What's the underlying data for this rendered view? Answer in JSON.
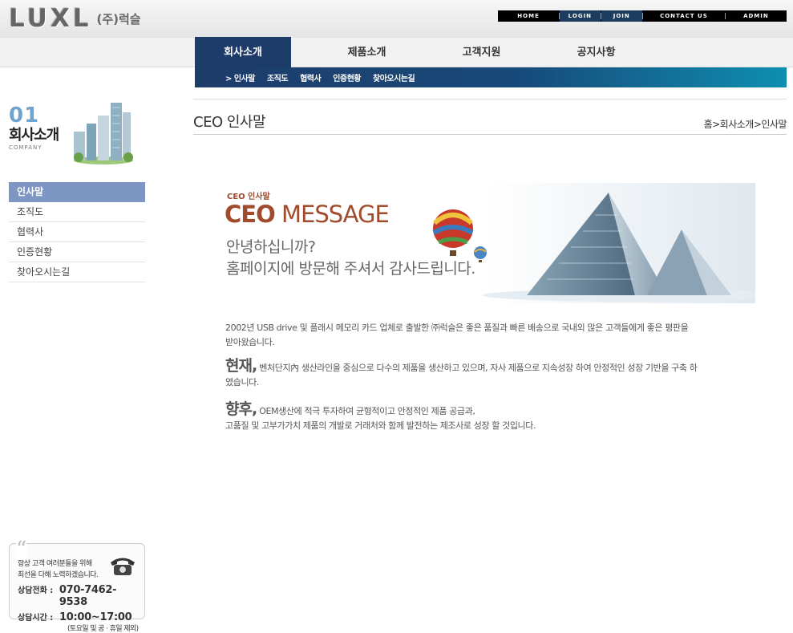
{
  "header": {
    "logo_word": "LUXL",
    "logo_company": "(주)럭슬",
    "util_links": [
      "HOME",
      "LOGIN",
      "JOIN",
      "CONTACT US",
      "ADMIN"
    ]
  },
  "gnb": {
    "items": [
      "회사소개",
      "제품소개",
      "고객지원",
      "공지사항"
    ],
    "active_index": 0
  },
  "subnav": {
    "items": [
      "> 인사말",
      "조직도",
      "협력사",
      "인증현황",
      "찾아오시는길"
    ]
  },
  "sidebar": {
    "section_number": "01",
    "section_title": "회사소개",
    "section_subtitle": "COMPANY",
    "menu": [
      "인사말",
      "조직도",
      "협력사",
      "인증현황",
      "찾아오시는길"
    ],
    "active_index": 0
  },
  "contact": {
    "line1": "항상 고객 여러분들을 위해",
    "line2": "최선을 다해 노력하겠습니다.",
    "phone_label": "상담전화 :",
    "phone_value": "070-7462-9538",
    "hours_label": "상담시간 :",
    "hours_value": "10:00~17:00",
    "hours_note": "(토요일 및 공 · 휴일 제외)"
  },
  "page": {
    "title": "CEO 인사말",
    "breadcrumb": "홈>회사소개>인사말"
  },
  "banner": {
    "small_label": "CEO 인사말",
    "big_bold": "CEO",
    "big_rest": " MESSAGE",
    "greeting_line1": "안녕하십니까?",
    "greeting_line2": "홈페이지에 방문해 주셔서 감사드립니다."
  },
  "content": {
    "p1": "2002년 USB drive 및 플래시 메모리 카드 업체로 출발한 ㈜럭슬은 좋은 품질과 빠른 배송으로 국내외 많은 고객들에게 좋은 평판을 받아왔습니다.",
    "p2_big": "현재,",
    "p2": " 벤처단지內 생산라인을 중심으로 다수의 제품을 생산하고 있으며, 자사 제품으로 지속성장 하여 안정적인  성장 기반을 구축 하였습니다.",
    "p3_big": "향후,",
    "p3_line1": " OEM생산에 적극 투자하여 균형적이고 안정적인 제품 공급과,",
    "p3_line2": "고품질 및 고부가가치 제품의 개발로 거래처와 함께 발전하는 제조사로 성장 할 것입니다."
  }
}
